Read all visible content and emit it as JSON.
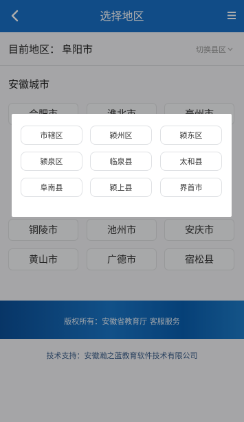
{
  "header": {
    "title": "选择地区",
    "back_icon": "chevron-left-icon",
    "menu_icon": "hamburger-menu-icon"
  },
  "current_region": {
    "label": "目前地区：",
    "value": "阜阳市",
    "switch_label": "切换县区"
  },
  "section": {
    "title": "安徽城市"
  },
  "cities": [
    "合肥市",
    "淮北市",
    "亳州市",
    "铜陵市",
    "池州市",
    "安庆市",
    "黄山市",
    "广德市",
    "宿松县"
  ],
  "footer": {
    "copyright": "版权所有：安徽省教育厅 客服服务",
    "support": "技术支持：安徽瀚之蓝教育软件技术有限公司"
  },
  "modal": {
    "options": [
      "市辖区",
      "颍州区",
      "颍东区",
      "颍泉区",
      "临泉县",
      "太和县",
      "阜南县",
      "颍上县",
      "界首市"
    ]
  },
  "colors": {
    "brand": "#1a70c8",
    "overlay": "rgba(0,0,0,0.32)"
  }
}
